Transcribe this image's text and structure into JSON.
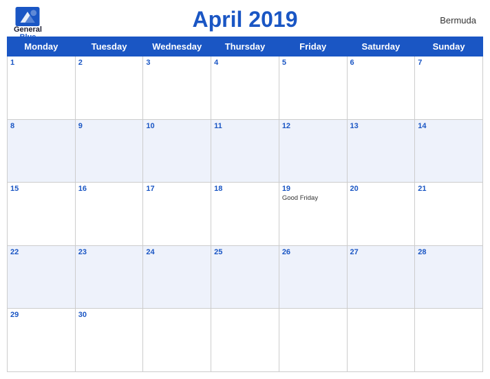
{
  "header": {
    "logo": {
      "general": "General",
      "blue": "Blue",
      "icon_alt": "GeneralBlue logo"
    },
    "title": "April 2019",
    "region": "Bermuda"
  },
  "calendar": {
    "days_of_week": [
      "Monday",
      "Tuesday",
      "Wednesday",
      "Thursday",
      "Friday",
      "Saturday",
      "Sunday"
    ],
    "weeks": [
      [
        {
          "day": 1,
          "events": []
        },
        {
          "day": 2,
          "events": []
        },
        {
          "day": 3,
          "events": []
        },
        {
          "day": 4,
          "events": []
        },
        {
          "day": 5,
          "events": []
        },
        {
          "day": 6,
          "events": []
        },
        {
          "day": 7,
          "events": []
        }
      ],
      [
        {
          "day": 8,
          "events": []
        },
        {
          "day": 9,
          "events": []
        },
        {
          "day": 10,
          "events": []
        },
        {
          "day": 11,
          "events": []
        },
        {
          "day": 12,
          "events": []
        },
        {
          "day": 13,
          "events": []
        },
        {
          "day": 14,
          "events": []
        }
      ],
      [
        {
          "day": 15,
          "events": []
        },
        {
          "day": 16,
          "events": []
        },
        {
          "day": 17,
          "events": []
        },
        {
          "day": 18,
          "events": []
        },
        {
          "day": 19,
          "events": [
            "Good Friday"
          ]
        },
        {
          "day": 20,
          "events": []
        },
        {
          "day": 21,
          "events": []
        }
      ],
      [
        {
          "day": 22,
          "events": []
        },
        {
          "day": 23,
          "events": []
        },
        {
          "day": 24,
          "events": []
        },
        {
          "day": 25,
          "events": []
        },
        {
          "day": 26,
          "events": []
        },
        {
          "day": 27,
          "events": []
        },
        {
          "day": 28,
          "events": []
        }
      ],
      [
        {
          "day": 29,
          "events": []
        },
        {
          "day": 30,
          "events": []
        },
        {
          "day": null,
          "events": []
        },
        {
          "day": null,
          "events": []
        },
        {
          "day": null,
          "events": []
        },
        {
          "day": null,
          "events": []
        },
        {
          "day": null,
          "events": []
        }
      ]
    ]
  }
}
